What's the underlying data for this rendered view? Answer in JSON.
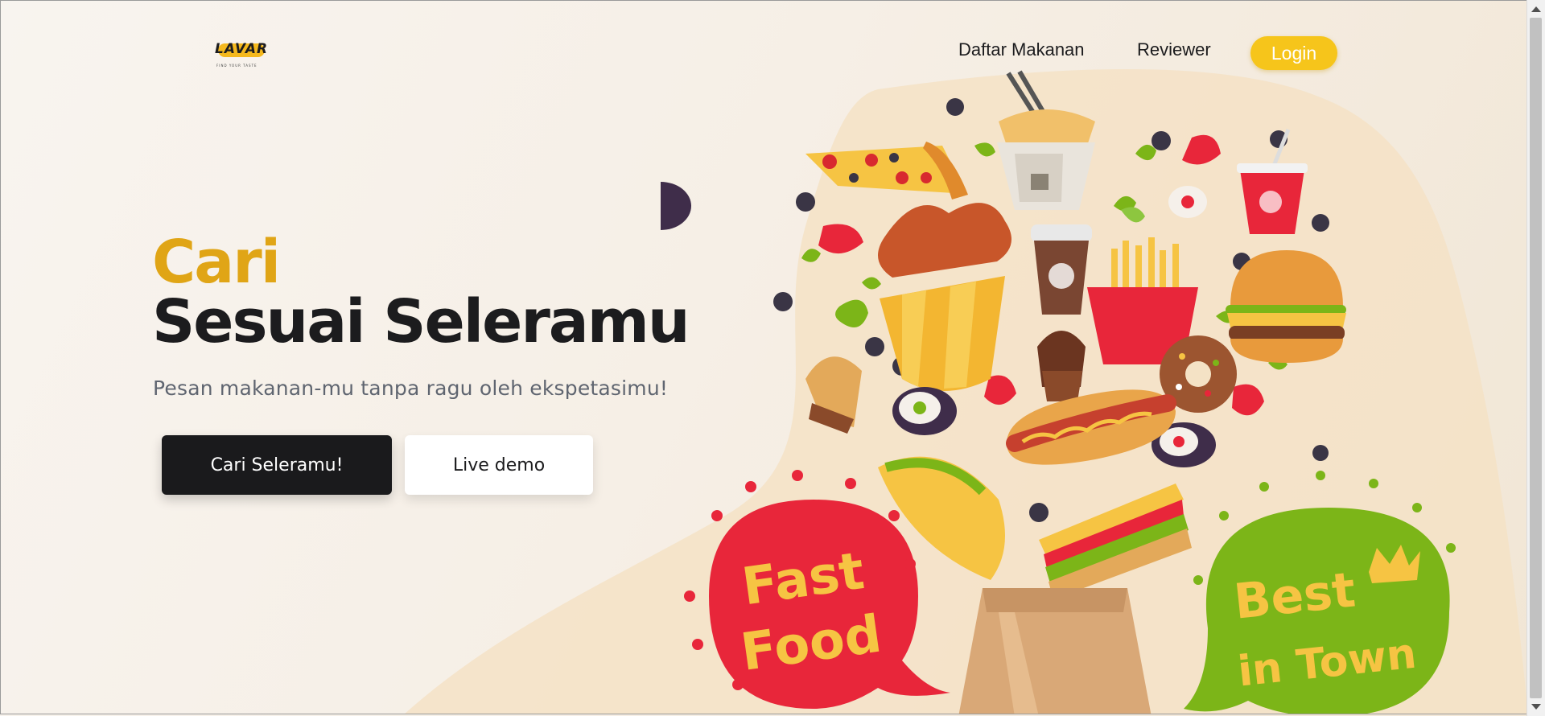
{
  "brand": {
    "logo_text": "LAVAR",
    "logo_tagline": "FIND YOUR TASTE"
  },
  "nav": {
    "items": [
      {
        "label": "Daftar Makanan"
      },
      {
        "label": "Reviewer"
      }
    ],
    "login_label": "Login"
  },
  "hero": {
    "title_line1": "Cari",
    "title_line2": "Sesuai Seleramu",
    "subtitle": "Pesan makanan-mu tanpa ragu oleh ekspetasimu!",
    "primary_button": "Cari Seleramu!",
    "secondary_button": "Live demo"
  },
  "illustration": {
    "badge_left": [
      "Fast",
      "Food"
    ],
    "badge_right": [
      "Best",
      "in Town"
    ]
  },
  "colors": {
    "accent": "#e0a516",
    "login_bg": "#f6c51b",
    "dark": "#1a1a1c",
    "subtitle": "#5f6570",
    "badge_red": "#e8263a",
    "badge_green": "#7cb518"
  }
}
